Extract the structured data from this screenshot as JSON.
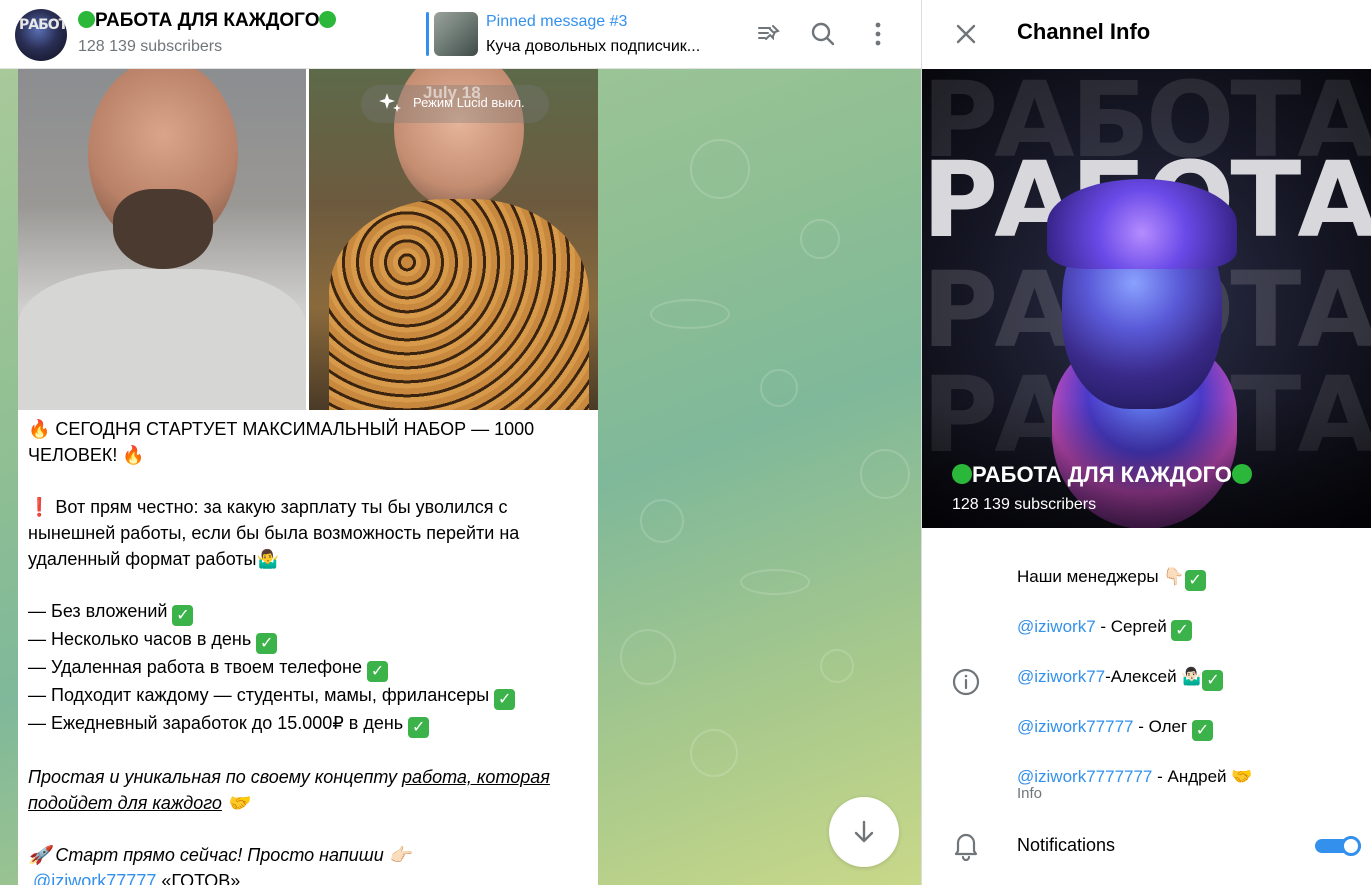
{
  "chat": {
    "title": "РАБОТА ДЛЯ КАЖДОГО",
    "subscribers": "128 139 subscribers",
    "avatar_text": "РАБОТА",
    "pinned": {
      "label": "Pinned message #3",
      "text": "Куча довольных подписчик..."
    },
    "icons": [
      "unpin-icon",
      "search-icon",
      "more-vertical-icon"
    ]
  },
  "media": {
    "date": "July 18",
    "lucid_label": "Режим Lucid выкл."
  },
  "message": {
    "line1": "🔥 СЕГОДНЯ СТАРТУЕТ МАКСИМАЛЬНЫЙ НАБОР — 1000 ЧЕЛОВЕК! 🔥",
    "line2": "❗ Вот прям честно: за какую зарплату ты бы уволился с нынешней работы, если бы была возможность перейти на удаленный формат работы🤷‍♂️",
    "bullets": [
      "— Без вложений",
      "— Несколько часов в день",
      "— Удаленная работа в твоем телефоне",
      "— Подходит каждому — студенты, мамы, фрилансеры",
      "— Ежедневный заработок до 15.000₽ в день"
    ],
    "italic_prefix": "Простая и уникальная по своему концепту ",
    "italic_underlined": "работа, которая подойдет для каждого",
    "italic_suffix": " 🤝",
    "cta": "🚀 Старт прямо сейчас! Просто напиши 👉🏻",
    "cta_link": "@iziwork77777",
    "cta_suffix": " «ГОТОВ»"
  },
  "info": {
    "title": "Channel Info",
    "cover_word": "РАБОТА",
    "channel_name": "РАБОТА ДЛЯ КАЖДОГО",
    "subscribers": "128 139 subscribers",
    "description": {
      "heading": "Наши менеджеры 👇🏻",
      "managers": [
        {
          "handle": "@iziwork7",
          "name": " - Сергей"
        },
        {
          "handle": "@iziwork77",
          "name": "-Алексей 🤷🏻‍♂️"
        },
        {
          "handle": "@iziwork77777",
          "name": " - Олег"
        },
        {
          "handle": "@iziwork7777777",
          "name": " - Андрей 🤝"
        }
      ],
      "label": "Info"
    },
    "notifications_label": "Notifications",
    "notifications_on": true,
    "accent_color": "#3390ec",
    "check_color": "#3cb34a",
    "dot_color": "#2bb83a"
  }
}
